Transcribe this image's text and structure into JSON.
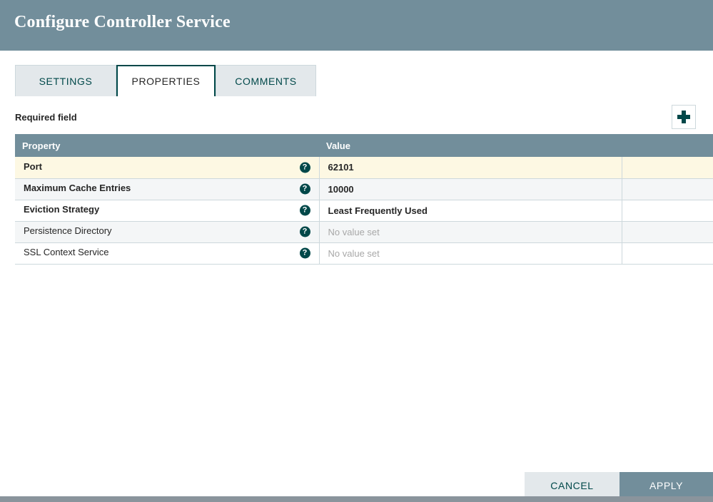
{
  "dialog": {
    "title": "Configure Controller Service"
  },
  "tabs": [
    {
      "label": "SETTINGS",
      "active": false
    },
    {
      "label": "PROPERTIES",
      "active": true
    },
    {
      "label": "COMMENTS",
      "active": false
    }
  ],
  "properties_tab": {
    "required_field_label": "Required field",
    "add_button_icon": "plus-icon",
    "table": {
      "columns": [
        "Property",
        "Value",
        ""
      ],
      "rows": [
        {
          "property": "Port",
          "required": true,
          "help_icon": "help-circle-icon",
          "value": "62101",
          "value_set": true,
          "extra": "",
          "row_style": "highlight"
        },
        {
          "property": "Maximum Cache Entries",
          "required": true,
          "help_icon": "help-circle-icon",
          "value": "10000",
          "value_set": true,
          "extra": "",
          "row_style": "odd"
        },
        {
          "property": "Eviction Strategy",
          "required": true,
          "help_icon": "help-circle-icon",
          "value": "Least Frequently Used",
          "value_set": true,
          "extra": "",
          "row_style": "even"
        },
        {
          "property": "Persistence Directory",
          "required": false,
          "help_icon": "help-circle-icon",
          "value": "No value set",
          "value_set": false,
          "extra": "",
          "row_style": "odd"
        },
        {
          "property": "SSL Context Service",
          "required": false,
          "help_icon": "help-circle-icon",
          "value": "No value set",
          "value_set": false,
          "extra": "",
          "row_style": "even"
        }
      ]
    }
  },
  "footer": {
    "cancel_label": "CANCEL",
    "apply_label": "APPLY"
  },
  "colors": {
    "header_bar": "#728e9b",
    "accent_teal": "#004849",
    "tab_inactive": "#e3e8eb",
    "row_highlight": "#fdf8e3",
    "row_alt": "#f4f6f7",
    "border": "#cdd8dc",
    "placeholder_text": "#a8a8a8",
    "scrollbar": "#8a949c"
  }
}
